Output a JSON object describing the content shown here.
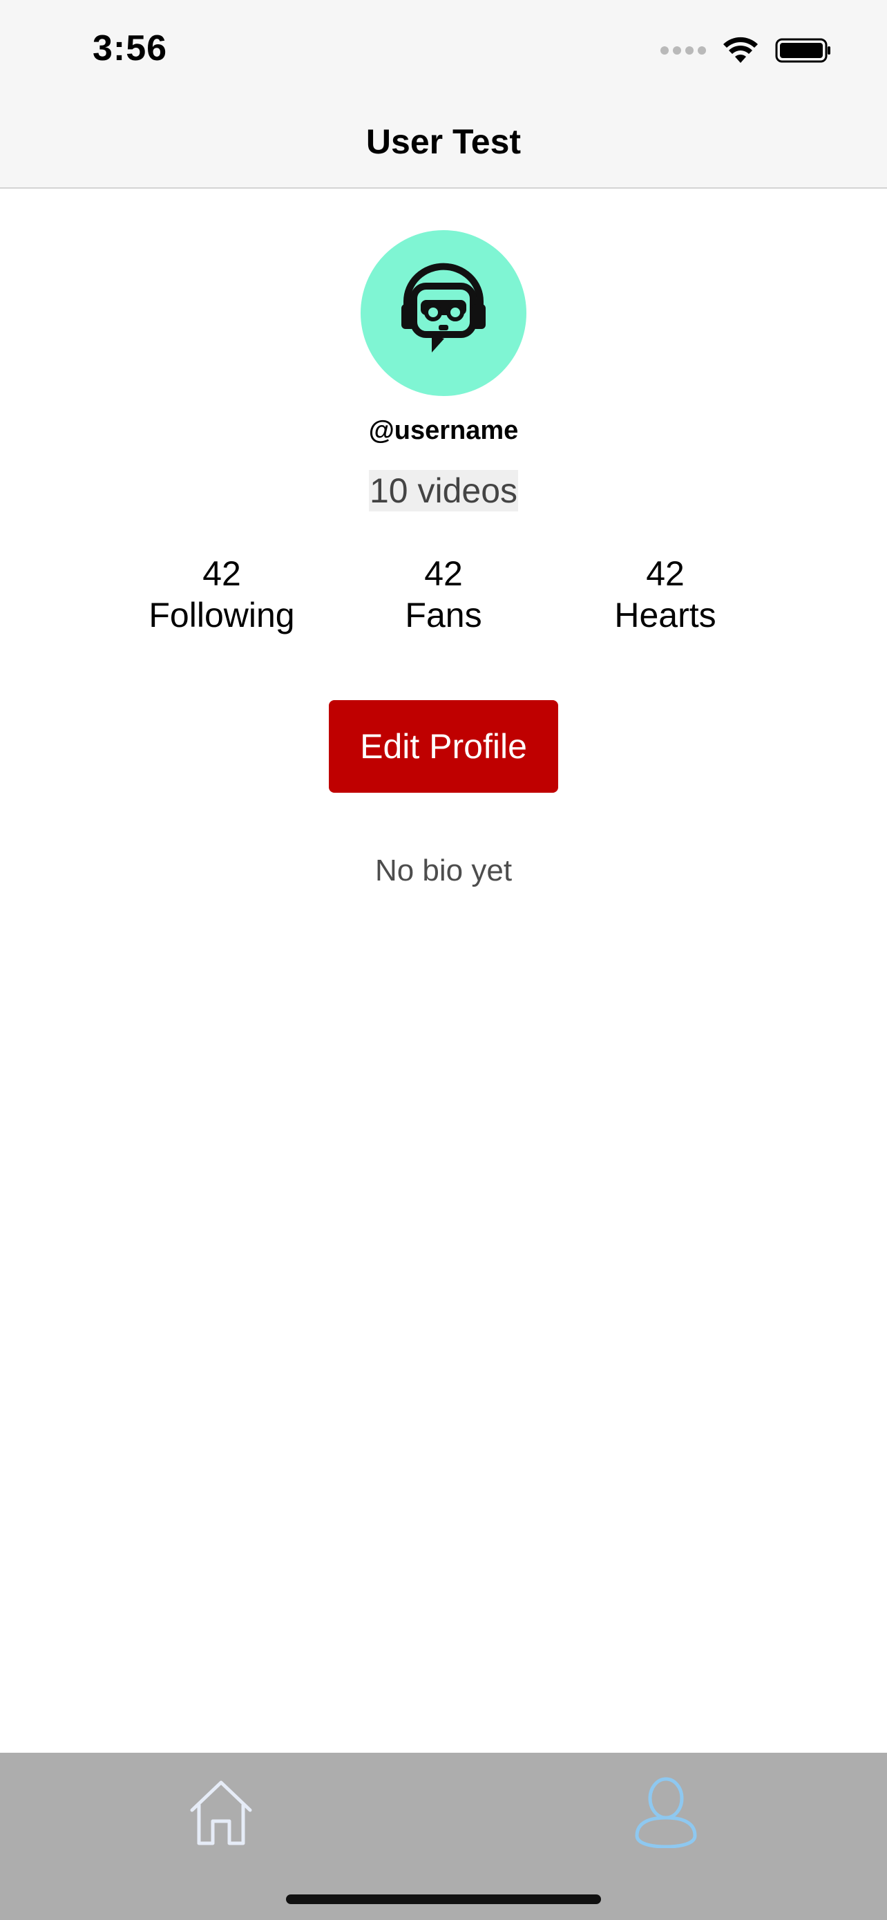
{
  "status_bar": {
    "time": "3:56"
  },
  "nav": {
    "title": "User Test"
  },
  "profile": {
    "username": "@username",
    "videos": "10 videos",
    "stats": [
      {
        "value": "42",
        "label": "Following"
      },
      {
        "value": "42",
        "label": "Fans"
      },
      {
        "value": "42",
        "label": "Hearts"
      }
    ],
    "edit_button_label": "Edit Profile",
    "bio": "No bio yet"
  },
  "colors": {
    "avatar_bg": "#7ff5d3",
    "edit_button": "#bf0000",
    "tab_active": "#8ec8f0",
    "tab_inactive": "#e6ecf7",
    "tabbar_bg": "#adadad"
  },
  "tabs": [
    {
      "icon": "home-icon",
      "active": false
    },
    {
      "icon": "profile-icon",
      "active": true
    }
  ]
}
